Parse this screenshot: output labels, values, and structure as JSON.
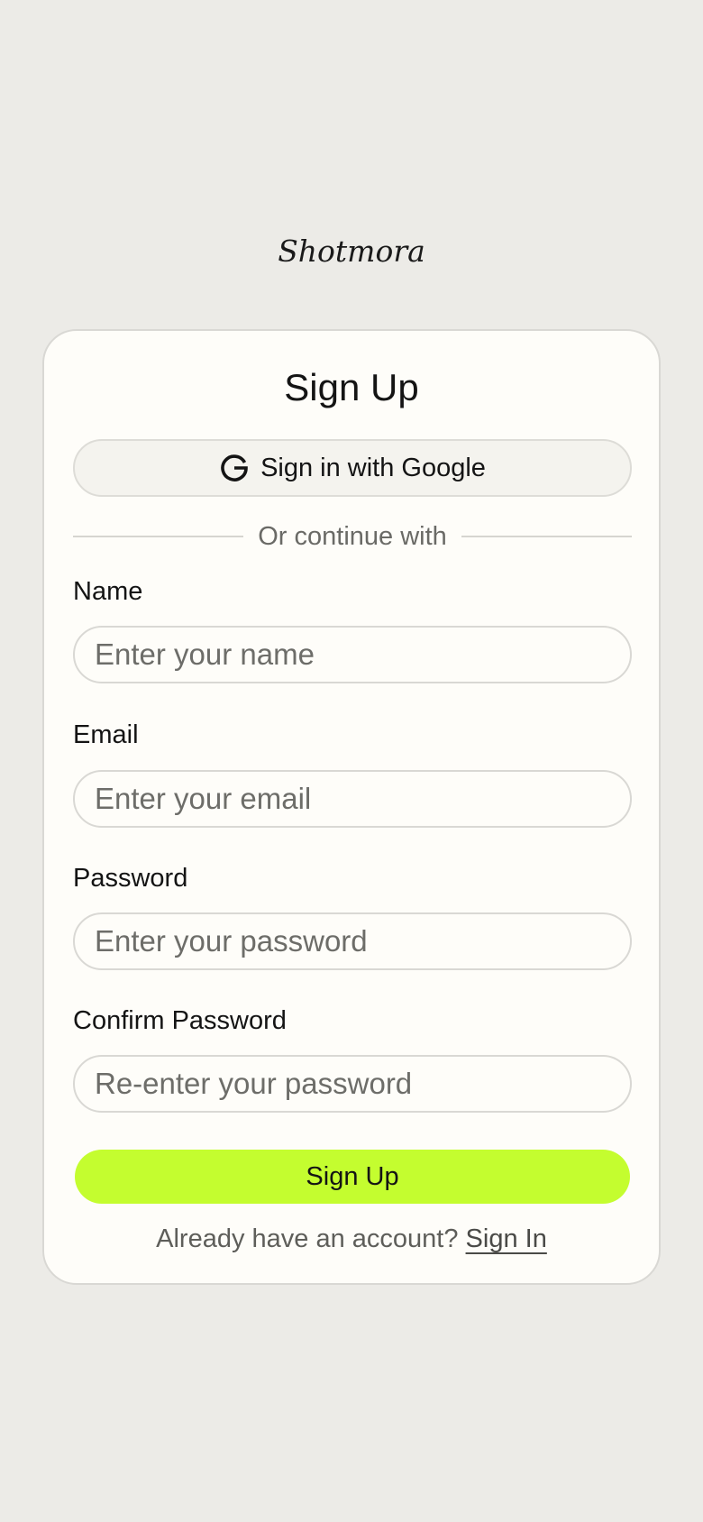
{
  "app": {
    "brand": "Shotmora"
  },
  "card": {
    "title": "Sign Up",
    "google_button_label": "Sign in with Google",
    "divider_text": "Or continue with",
    "fields": [
      {
        "label": "Name",
        "placeholder": "Enter your name",
        "value": ""
      },
      {
        "label": "Email",
        "placeholder": "Enter your email",
        "value": ""
      },
      {
        "label": "Password",
        "placeholder": "Enter your password",
        "value": ""
      },
      {
        "label": "Confirm Password",
        "placeholder": "Re-enter your password",
        "value": ""
      }
    ],
    "submit_label": "Sign Up",
    "footer_prompt": "Already have an account?",
    "signin_link": "Sign In"
  },
  "icons": {
    "google": "google-g-icon"
  },
  "colors": {
    "page_background": "#ecebe7",
    "card_background": "#fefdf9",
    "accent": "#c4fd2f"
  }
}
